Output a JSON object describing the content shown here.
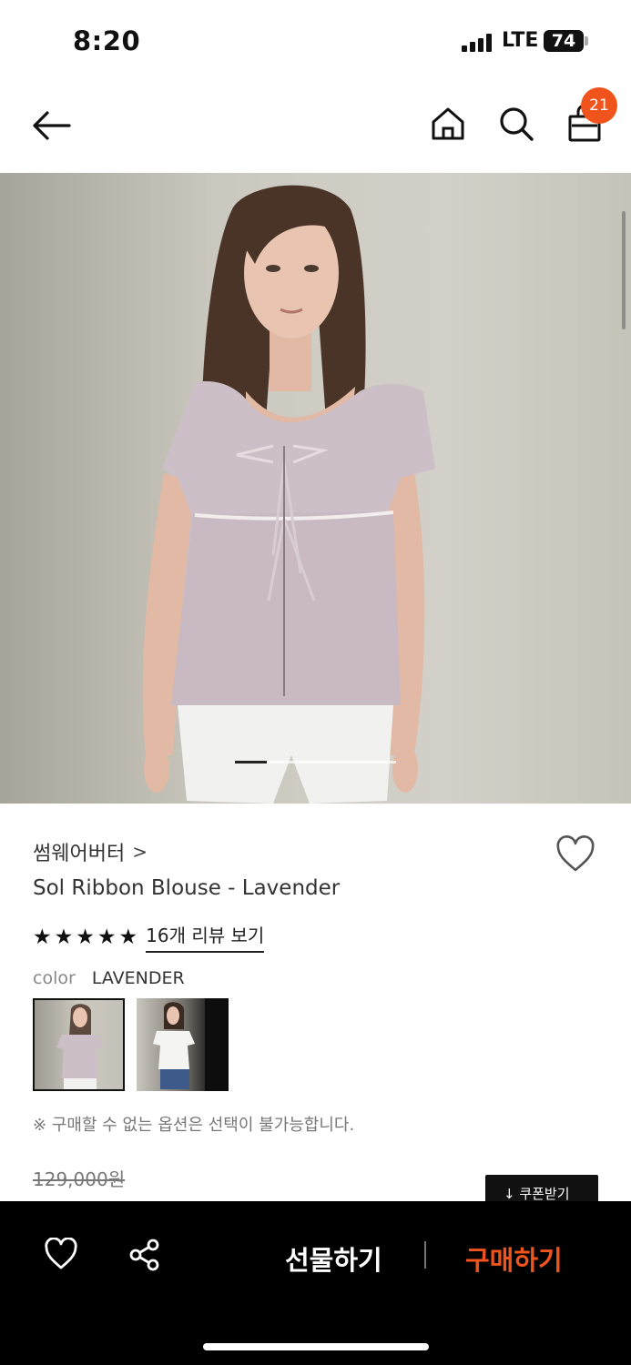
{
  "status_bar": {
    "time": "8:20",
    "network": "LTE",
    "battery": "74"
  },
  "header": {
    "cart_count": "21"
  },
  "hero": {
    "image_index": 1,
    "image_count": 5
  },
  "product": {
    "brand": "썸웨어버터",
    "brand_chevron": ">",
    "name": "Sol Ribbon Blouse - Lavender",
    "rating_stars": 5,
    "review_link": "16개 리뷰 보기",
    "option_label": "color",
    "option_value": "LAVENDER",
    "notice": "※ 구매할 수 없는 옵션은 선택이 불가능합니다.",
    "original_price": "129,000원",
    "coupon_button": "↓ 쿠폰받기"
  },
  "bottom_bar": {
    "gift_label": "선물하기",
    "buy_label": "구매하기"
  },
  "colors": {
    "accent": "#f0531c",
    "bottom_bar_bg": "#000000",
    "blouse": "#cdbfc7"
  },
  "icons": [
    "back-arrow-icon",
    "home-icon",
    "search-icon",
    "shopping-bag-icon",
    "heart-icon",
    "share-icon",
    "star-icon"
  ]
}
